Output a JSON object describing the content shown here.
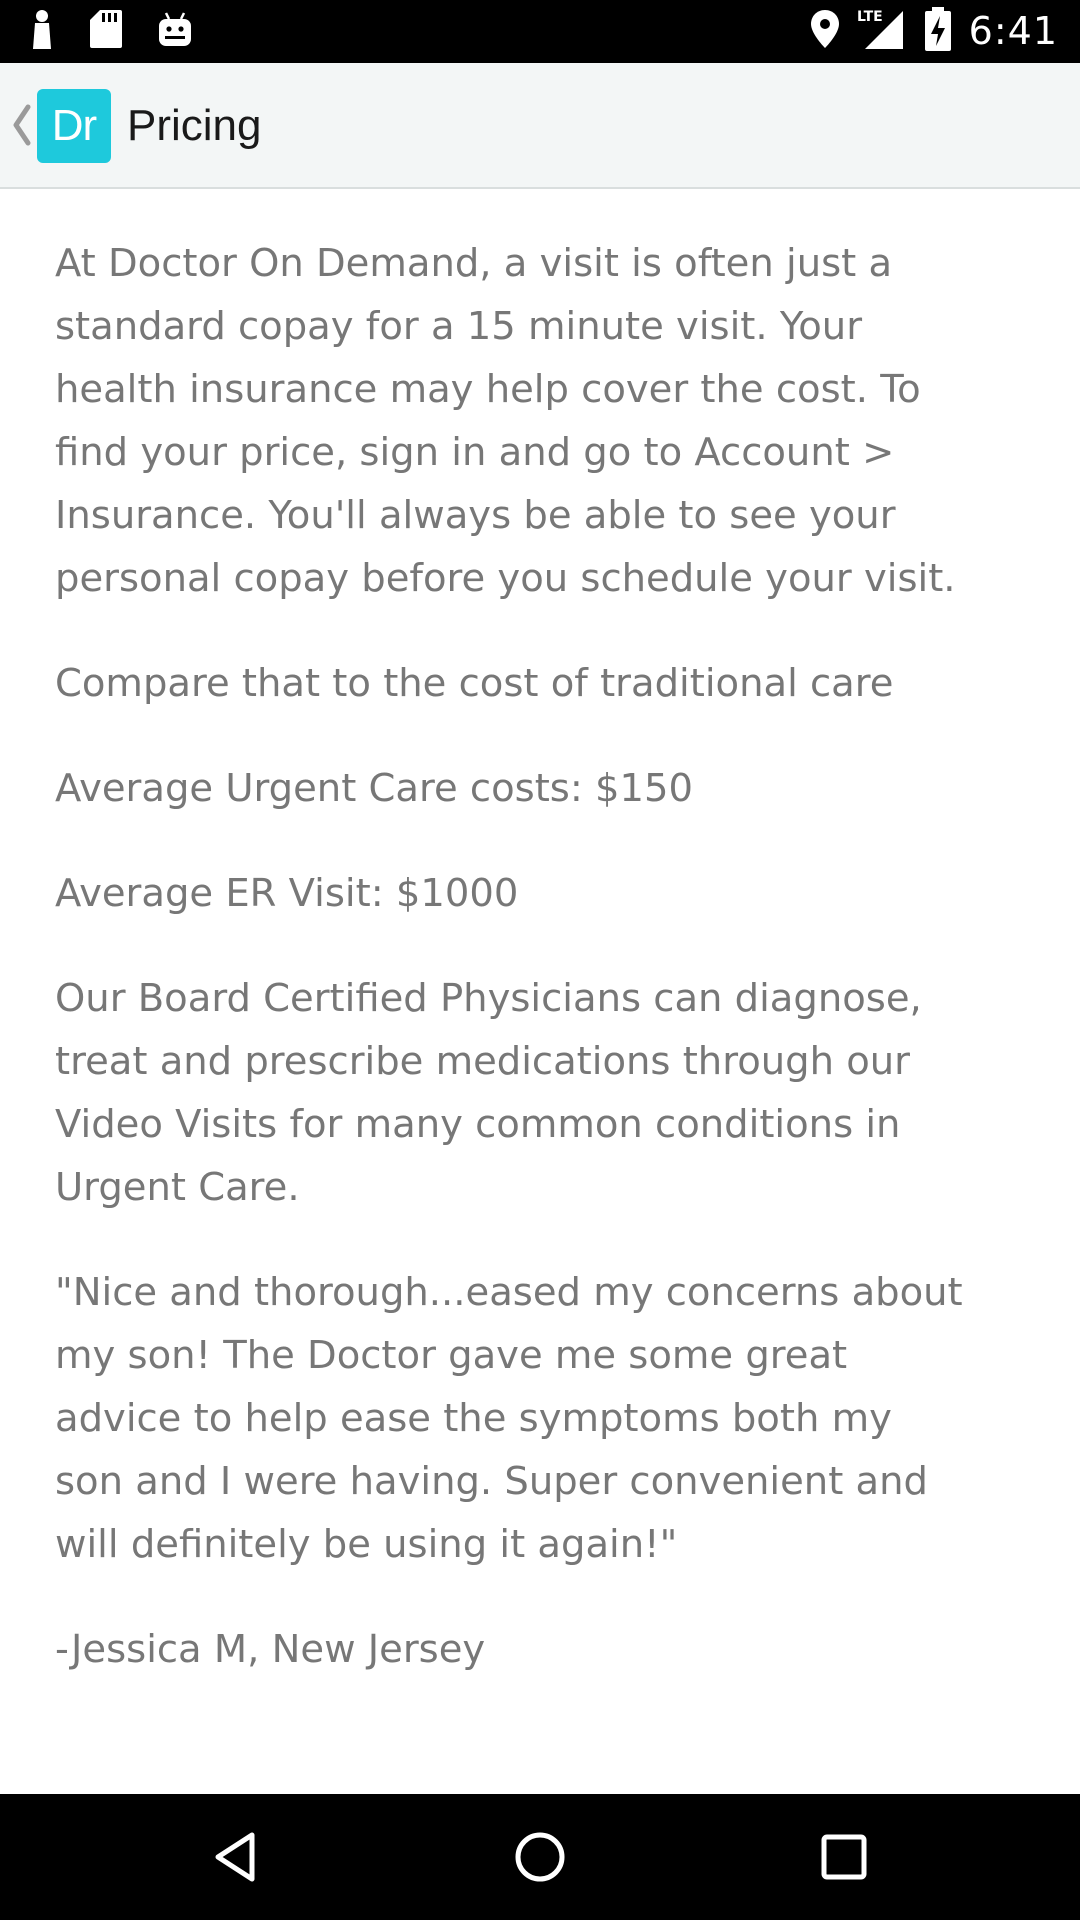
{
  "status_bar": {
    "time": "6:41",
    "network": "LTE",
    "icons": [
      "notification-person-icon",
      "sd-card-icon",
      "android-icon",
      "location-icon",
      "signal-icon",
      "battery-charging-icon"
    ]
  },
  "app_bar": {
    "logo_text": "Dr",
    "title": "Pricing",
    "logo_color": "#1ec9dc"
  },
  "content": {
    "paragraphs": [
      "At Doctor On Demand, a visit is often just a\nstandard copay for a 15 minute visit. Your\nhealth insurance may help cover the cost. To\nfind your price, sign in and go to Account >\nInsurance. You'll always be able to see your\npersonal copay before you schedule your visit.",
      "Compare that to the cost of traditional care",
      "Average Urgent Care costs: $150",
      "Average ER Visit: $1000",
      "Our Board Certified Physicians can diagnose,\ntreat and prescribe medications through our\nVideo Visits for many common conditions in\nUrgent Care.",
      "\"Nice and thorough...eased my concerns about\nmy son! The Doctor gave me some great\nadvice to help ease the symptoms both my\nson and I were having. Super convenient and\nwill definitely be using it again!\"",
      "-Jessica M, New Jersey"
    ]
  },
  "nav_bar": {
    "buttons": [
      "back-icon",
      "home-icon",
      "recents-icon"
    ]
  }
}
